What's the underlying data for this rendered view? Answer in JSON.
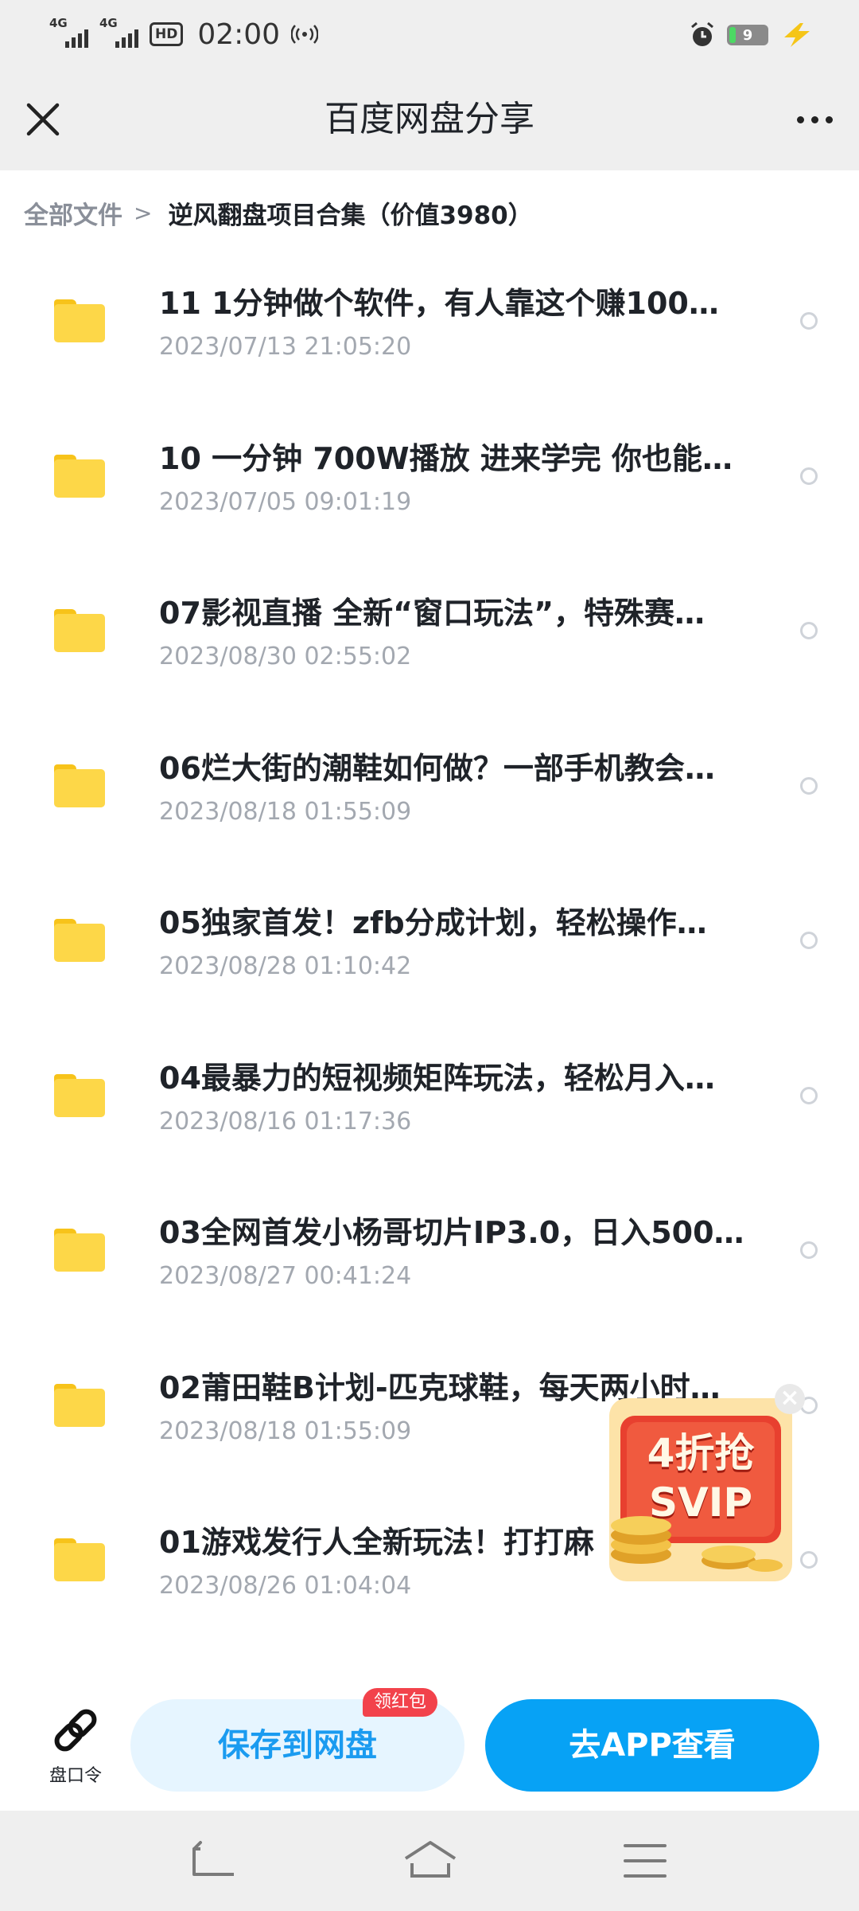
{
  "status_bar": {
    "sim1": "4G",
    "sim2": "4G",
    "hd": "HD",
    "time": "02:00",
    "battery": "9",
    "icons": [
      "signal-icon",
      "hd-voice-icon",
      "hotspot-icon",
      "alarm-icon",
      "battery-icon",
      "charging-icon"
    ]
  },
  "header": {
    "title": "百度网盘分享",
    "close_icon": "close-icon",
    "more_icon": "more-icon"
  },
  "breadcrumb": {
    "root": "全部文件",
    "separator": ">",
    "current": "逆风翻盘项目合集（价值3980）"
  },
  "files": [
    {
      "name": "11 1分钟做个软件，有人靠这个赚100W…",
      "date": "2023/07/13 21:05:20"
    },
    {
      "name": "10 一分钟 700W播放 进来学完 你也能…",
      "date": "2023/07/05 09:01:19"
    },
    {
      "name": "07影视直播 全新“窗口玩法”，特殊赛…",
      "date": "2023/08/30 02:55:02"
    },
    {
      "name": "06烂大街的潮鞋如何做？一部手机教会…",
      "date": "2023/08/18 01:55:09"
    },
    {
      "name": "05独家首发！zfb分成计划，轻松操作…",
      "date": "2023/08/28 01:10:42"
    },
    {
      "name": "04最暴力的短视频矩阵玩法，轻松月入…",
      "date": "2023/08/16 01:17:36"
    },
    {
      "name": "03全网首发小杨哥切片IP3.0，日入500…",
      "date": "2023/08/27 00:41:24"
    },
    {
      "name": "02莆田鞋B计划-匹克球鞋，每天两小时…",
      "date": "2023/08/18 01:55:09"
    },
    {
      "name": "01游戏发行人全新玩法！打打麻",
      "date": "2023/08/26 01:04:04"
    }
  ],
  "promo": {
    "line1": "4折抢",
    "line2": "SVIP",
    "close": "×"
  },
  "action_bar": {
    "pan_command_label": "盘口令",
    "save_button": "保存到网盘",
    "save_badge": "领红包",
    "open_app_button": "去APP查看"
  },
  "colors": {
    "accent": "#07a2f5",
    "folder": "#fdd748",
    "badge": "#f2424b",
    "bar_bg": "#efefef"
  }
}
